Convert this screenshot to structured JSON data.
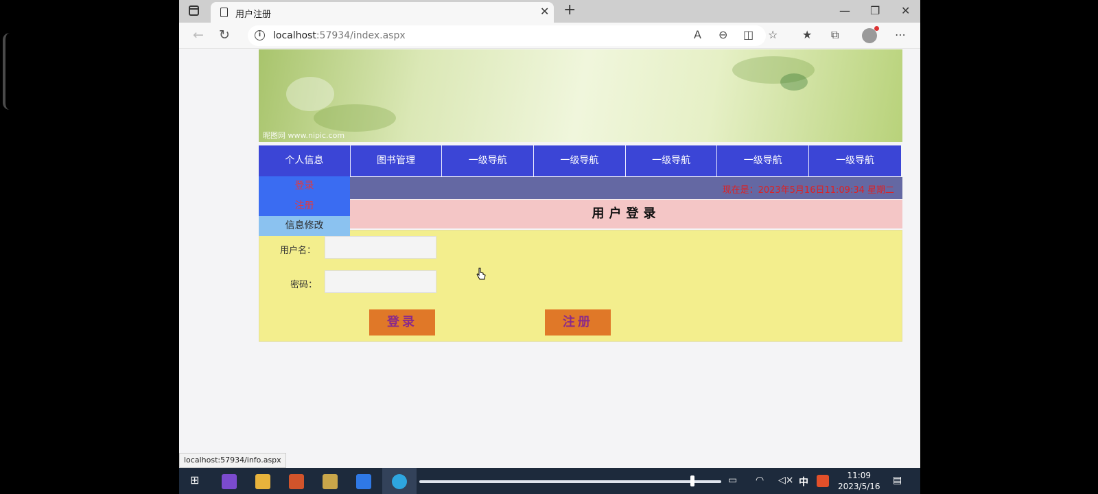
{
  "browser": {
    "tab_title": "用户注册",
    "url_host": "localhost",
    "url_rest": ":57934/index.aspx",
    "status_url": "localhost:57934/info.aspx"
  },
  "nav": {
    "items": [
      "个人信息",
      "图书管理",
      "一级导航",
      "一级导航",
      "一级导航",
      "一级导航",
      "一级导航"
    ]
  },
  "dropdown": {
    "items": [
      "登录",
      "注册",
      "信息修改"
    ],
    "hovered_index": 2
  },
  "time_text": "现在是：2023年5月16日11:09:34 星期二",
  "page_title": "用户登录",
  "form": {
    "username_label": "用户名：",
    "password_label": "密码：",
    "login_button": "登录",
    "register_button": "注册"
  },
  "banner": {
    "watermark": "昵图网 www.nipic.com"
  },
  "taskbar": {
    "clock_time": "11:09",
    "clock_date": "2023/5/16",
    "ime": "中"
  },
  "colors": {
    "nav": "#3b45d6",
    "dropdown": "#3a6cf2",
    "dropdown_hover": "#8bc2f0",
    "timebar": "#6468a3",
    "title_bg": "#f4c6c6",
    "form_bg": "#f3ee8d",
    "button": "#e07828"
  }
}
